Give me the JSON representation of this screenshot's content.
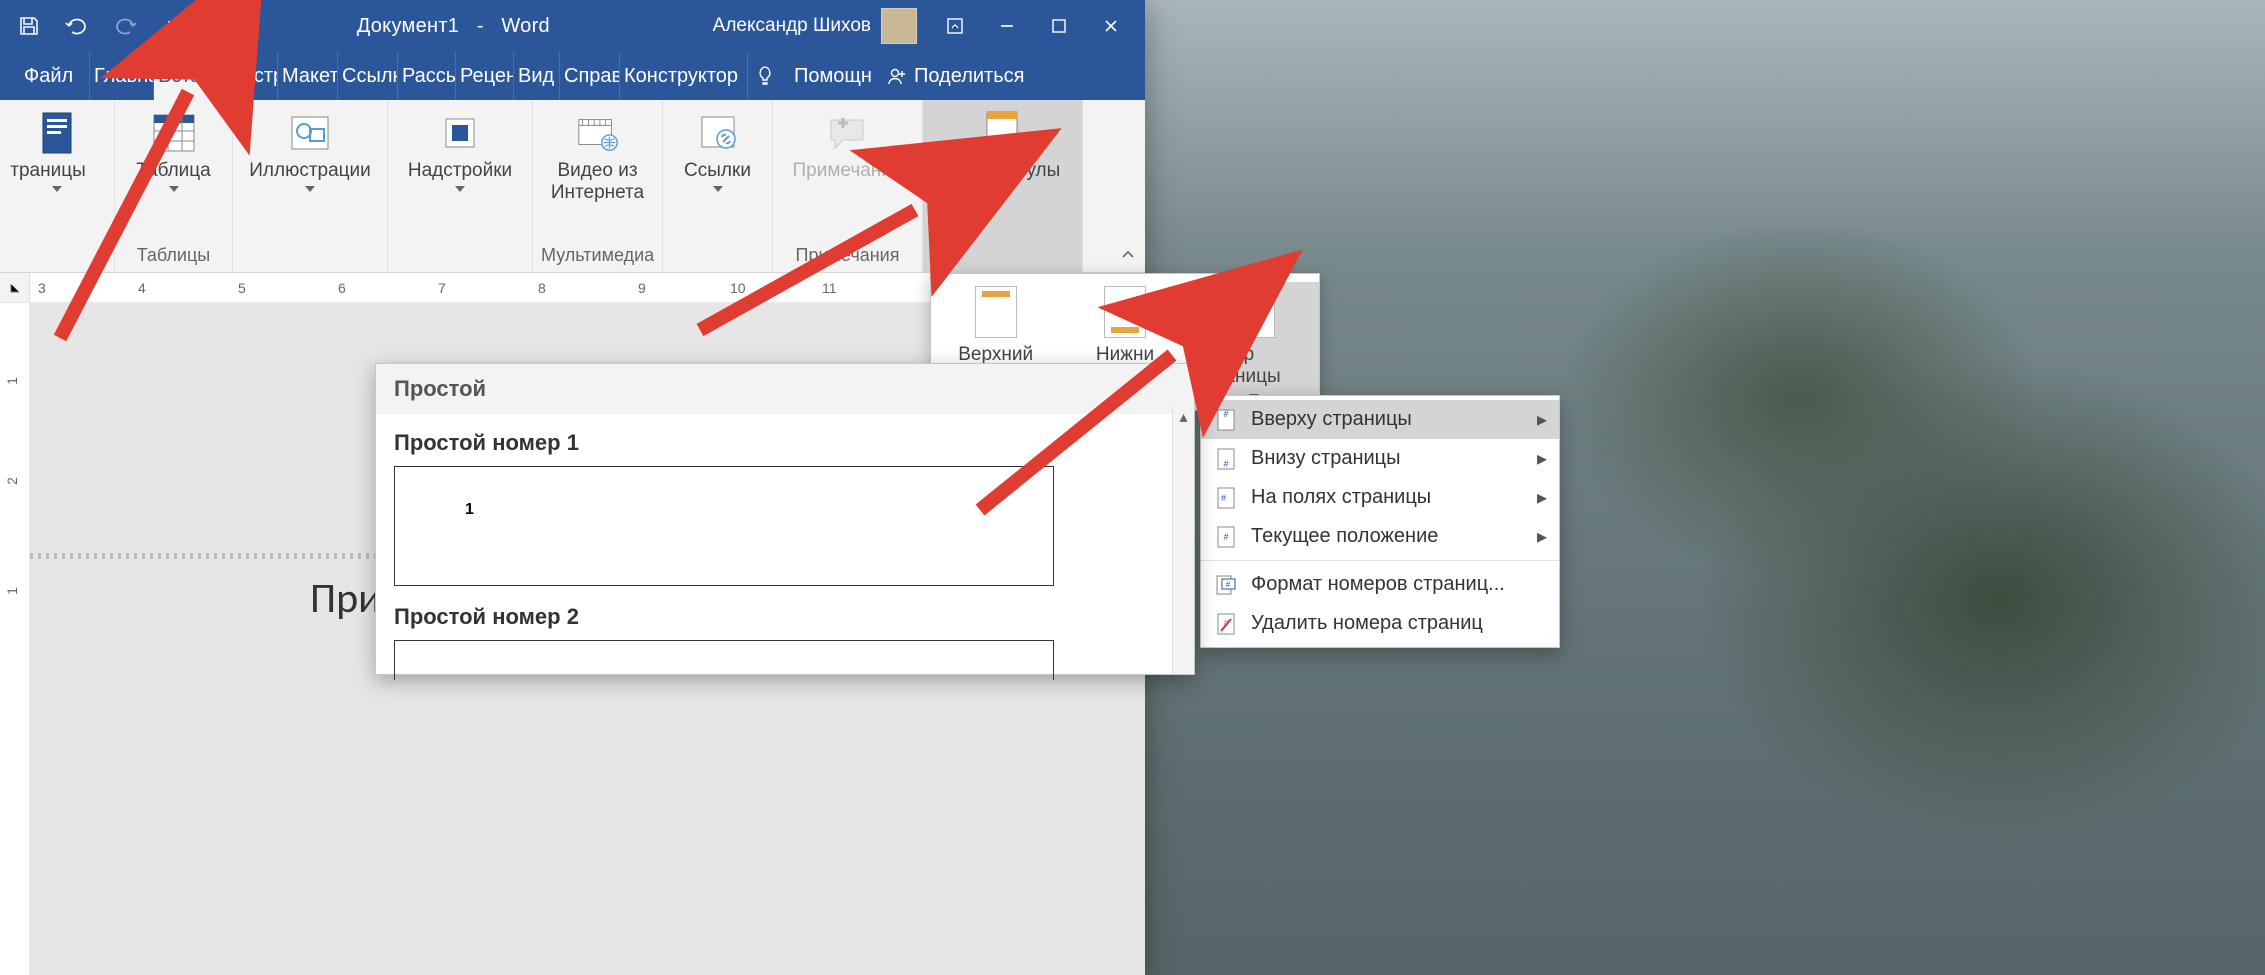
{
  "title": {
    "doc": "Документ1",
    "sep": "-",
    "app": "Word"
  },
  "user": {
    "name": "Александр Шихов"
  },
  "qat": {
    "save": "save",
    "undo": "undo",
    "redo": "redo",
    "customize": "customize"
  },
  "tabs": {
    "file": "Файл",
    "home": "Главна",
    "insert": "Вставк",
    "design": "Констр",
    "layout": "Макет",
    "references": "Ссылк",
    "mailings": "Рассы",
    "review": "Рецен",
    "view": "Вид",
    "help": "Справ",
    "constructor": "Конструктор",
    "assist": "Помощн",
    "share": "Поделиться"
  },
  "ribbon": {
    "pages": {
      "label": "траницы",
      "group": ""
    },
    "tables": {
      "btn": "Таблица",
      "group": "Таблицы"
    },
    "illustrations": {
      "btn": "Иллюстрации",
      "group": ""
    },
    "addins": {
      "btn": "Надстройки",
      "group": ""
    },
    "media": {
      "btn": "Видео из Интернета",
      "group": "Мультимедиа"
    },
    "links": {
      "btn": "Ссылки",
      "group": ""
    },
    "comments": {
      "btn": "Примечание",
      "group": "Примечания"
    },
    "headerfooter": {
      "btn": "Колонтитулы",
      "group": ""
    }
  },
  "hf": {
    "header": "Верхний",
    "footer": "Нижни",
    "pagenum": "Номер страницы"
  },
  "pnmenu": {
    "top": "Вверху страницы",
    "bottom": "Внизу страницы",
    "margins": "На полях страницы",
    "current": "Текущее положение",
    "format": "Формат номеров страниц...",
    "remove": "Удалить номера страниц"
  },
  "gallery": {
    "section": "Простой",
    "item1": "Простой номер 1",
    "item2": "Простой номер 2",
    "preview_num": "1"
  },
  "doc": {
    "visible_text": "При"
  },
  "ruler": {
    "nums": [
      "3",
      "4",
      "5",
      "6",
      "7",
      "8",
      "9",
      "10",
      "11"
    ]
  },
  "vruler": {
    "nums": [
      "1",
      "2",
      "1"
    ]
  }
}
